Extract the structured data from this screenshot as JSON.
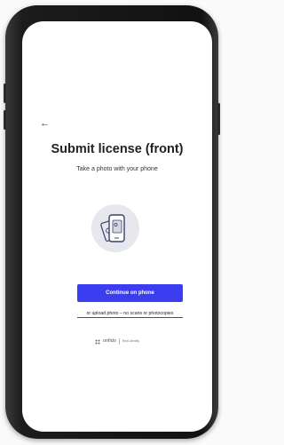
{
  "header": {
    "back_icon": "arrow-left-icon"
  },
  "main": {
    "title": "Submit license (front)",
    "subtitle": "Take a photo with your phone",
    "illustration_icon": "phone-with-document-icon"
  },
  "actions": {
    "primary_label": "Continue on phone",
    "upload_link": "or upload photo – no scans or photocopies"
  },
  "footer": {
    "brand": "onfido",
    "tagline": "Real identity"
  },
  "colors": {
    "accent": "#3a3ef0",
    "title": "#222222",
    "illustration_bg": "#e6e8ee"
  }
}
